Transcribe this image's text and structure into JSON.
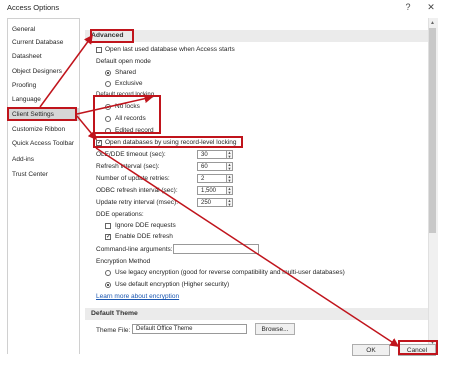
{
  "window": {
    "title": "Access Options",
    "help_glyph": "?",
    "close_glyph": "✕"
  },
  "sidebar": {
    "items": [
      {
        "label": "General"
      },
      {
        "label": "Current Database"
      },
      {
        "label": "Datasheet"
      },
      {
        "label": "Object Designers"
      },
      {
        "label": "Proofing"
      },
      {
        "label": "Language"
      },
      {
        "label": "Client Settings"
      },
      {
        "label": "Customize Ribbon"
      },
      {
        "label": "Quick Access Toolbar"
      },
      {
        "label": "Add-ins"
      },
      {
        "label": "Trust Center"
      }
    ],
    "selected": "Client Settings"
  },
  "advanced": {
    "header": "Advanced",
    "open_last_used": "Open last used database when Access starts",
    "default_open_mode_label": "Default open mode",
    "shared": "Shared",
    "exclusive": "Exclusive",
    "record_locking_label": "Default record locking",
    "no_locks": "No locks",
    "all_records": "All records",
    "edited_record": "Edited record",
    "open_record_level": "Open databases by using record-level locking",
    "ole_timeout_label": "OLE/DDE timeout (sec):",
    "ole_timeout_value": "30",
    "refresh_interval_label": "Refresh interval (sec):",
    "refresh_interval_value": "60",
    "update_retries_label": "Number of update retries:",
    "update_retries_value": "2",
    "odbc_refresh_label": "ODBC refresh interval (sec):",
    "odbc_refresh_value": "1,500",
    "update_retry_interval_label": "Update retry interval (msec):",
    "update_retry_interval_value": "250",
    "dde_operations_label": "DDE operations:",
    "ignore_dde": "Ignore DDE requests",
    "enable_dde_refresh": "Enable DDE refresh",
    "cmdline_label": "Command-line arguments:",
    "encryption_label": "Encryption Method",
    "legacy_encryption": "Use legacy encryption (good for reverse compatibility and multi-user databases)",
    "default_encryption": "Use default encryption (Higher security)",
    "learn_more": "Learn more about encryption"
  },
  "default_theme": {
    "header": "Default Theme",
    "theme_file_label": "Theme File:",
    "theme_file_value": "Default Office Theme",
    "browse_label": "Browse..."
  },
  "footer": {
    "ok_label": "OK",
    "cancel_label": "Cancel"
  },
  "colors": {
    "annotation_red": "#c0141c",
    "selected_nav": "#d6d6d6",
    "section_header": "#ebebeb",
    "link": "#1a56b0"
  }
}
